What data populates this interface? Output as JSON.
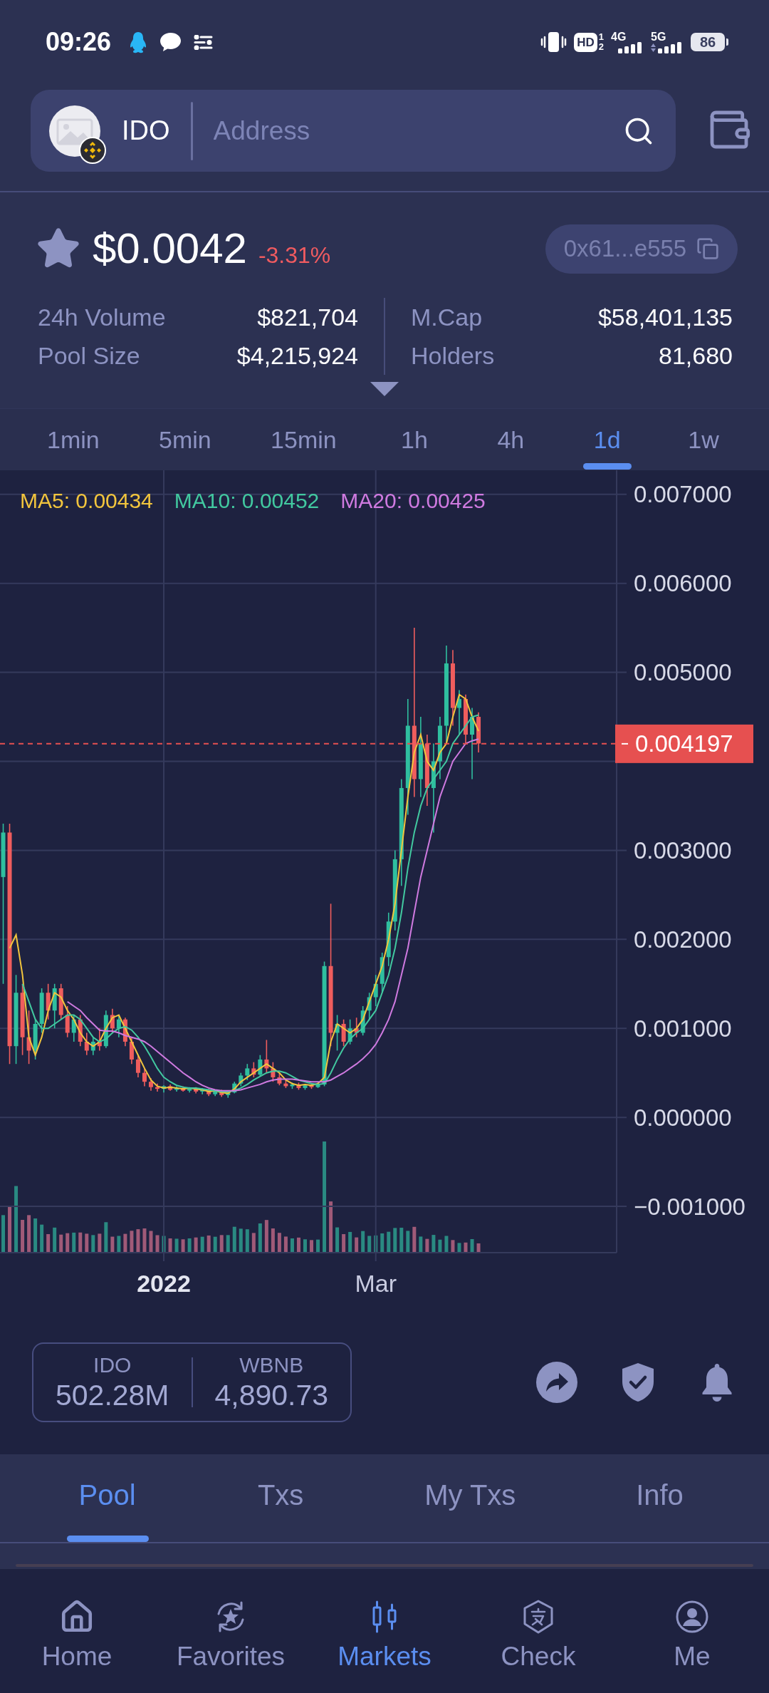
{
  "status_bar": {
    "time": "09:26",
    "hd": {
      "label": "HD",
      "slots": [
        "1",
        "2"
      ]
    },
    "networks": [
      "4G",
      "5G"
    ],
    "battery": "86"
  },
  "search_bar": {
    "token": "IDO",
    "placeholder": "Address"
  },
  "token": {
    "price": "$0.0042",
    "change": "-3.31%",
    "address": "0x61...e555"
  },
  "stats": [
    [
      {
        "label": "24h Volume",
        "value": "$821,704"
      },
      {
        "label": "Pool Size",
        "value": "$4,215,924"
      }
    ],
    [
      {
        "label": "M.Cap",
        "value": "$58,401,135"
      },
      {
        "label": "Holders",
        "value": "81,680"
      }
    ]
  ],
  "intervals": [
    {
      "label": "1min",
      "selected": false
    },
    {
      "label": "5min",
      "selected": false
    },
    {
      "label": "15min",
      "selected": false
    },
    {
      "label": "1h",
      "selected": false
    },
    {
      "label": "4h",
      "selected": false
    },
    {
      "label": "1d",
      "selected": true
    },
    {
      "label": "1w",
      "selected": false
    }
  ],
  "chart": {
    "legend": [
      {
        "value": ": 0.00434"
      },
      {
        "value": ": 0.00452"
      },
      {
        "value": ": 0.00425"
      }
    ],
    "chart_data": {
      "type": "candlestick",
      "grid": true,
      "categories": [
        null,
        null,
        null,
        null,
        null,
        null,
        null,
        null,
        null,
        null,
        null,
        null,
        null,
        null,
        null,
        null,
        null,
        null,
        null,
        null,
        null,
        null,
        null,
        null,
        null,
        "2022",
        null,
        null,
        null,
        null,
        null,
        null,
        null,
        null,
        null,
        null,
        null,
        null,
        null,
        null,
        null,
        null,
        null,
        null,
        null,
        null,
        null,
        null,
        null,
        null,
        null,
        null,
        null,
        null,
        null,
        null,
        null,
        null,
        "Mar",
        null,
        null,
        null,
        null,
        null,
        null,
        null,
        null,
        null,
        null,
        null,
        null,
        null,
        null,
        null,
        null,
        null,
        null,
        null,
        null,
        null,
        null,
        null,
        null,
        null,
        null,
        null,
        null,
        null,
        null,
        null,
        null,
        null,
        null,
        null,
        null,
        null
      ],
      "ylim": [
        -0.00152,
        0.00727
      ],
      "yticks": [
        {
          "value": 0.007,
          "label": "0.007000"
        },
        {
          "value": 0.006,
          "label": "0.006000"
        },
        {
          "value": 0.005,
          "label": "0.005000"
        },
        {
          "value": 0.003,
          "label": "0.003000"
        },
        {
          "value": 0.002,
          "label": "0.002000"
        },
        {
          "value": 0.001,
          "label": "0.001000"
        },
        {
          "value": 0,
          "label": "0.000000"
        },
        {
          "value": -0.001,
          "label": "−0.001000"
        }
      ],
      "ohlc": [
        [
          0.0027,
          0.0033,
          0.0015,
          0.0032
        ],
        [
          0.0032,
          0.0033,
          0.0006,
          0.0008
        ],
        [
          0.0008,
          0.0016,
          0.0006,
          0.0014
        ],
        [
          0.0014,
          0.0015,
          0.0007,
          0.0009
        ],
        [
          0.0009,
          0.0012,
          0.0006,
          0.00075
        ],
        [
          0.00075,
          0.0011,
          0.00065,
          0.00105
        ],
        [
          0.00105,
          0.00145,
          0.00095,
          0.0014
        ],
        [
          0.0014,
          0.0015,
          0.0011,
          0.0012
        ],
        [
          0.0012,
          0.0015,
          0.001,
          0.00145
        ],
        [
          0.00145,
          0.0015,
          0.0011,
          0.00115
        ],
        [
          0.00115,
          0.00125,
          0.0009,
          0.00095
        ],
        [
          0.00095,
          0.00115,
          0.00085,
          0.0011
        ],
        [
          0.0011,
          0.00115,
          0.0008,
          0.00085
        ],
        [
          0.00085,
          0.00095,
          0.0007,
          0.00075
        ],
        [
          0.00075,
          0.0009,
          0.0007,
          0.00085
        ],
        [
          0.00085,
          0.001,
          0.00075,
          0.0008
        ],
        [
          0.0008,
          0.0012,
          0.00078,
          0.00115
        ],
        [
          0.00115,
          0.00122,
          0.00095,
          0.001
        ],
        [
          0.001,
          0.00115,
          0.0009,
          0.0011
        ],
        [
          0.0011,
          0.00112,
          0.0008,
          0.00085
        ],
        [
          0.00085,
          0.0009,
          0.0006,
          0.00065
        ],
        [
          0.00065,
          0.0007,
          0.00045,
          0.0005
        ],
        [
          0.0005,
          0.00055,
          0.00035,
          0.0004
        ],
        [
          0.0004,
          0.00044,
          0.0003,
          0.00034
        ],
        [
          0.00034,
          0.00038,
          0.00029,
          0.00032
        ],
        [
          0.00032,
          0.00036,
          0.00028,
          0.00035
        ],
        [
          0.00035,
          0.00037,
          0.0003,
          0.00031
        ],
        [
          0.00031,
          0.00035,
          0.00029,
          0.00033
        ],
        [
          0.00033,
          0.00035,
          0.00029,
          0.0003
        ],
        [
          0.0003,
          0.00034,
          0.00028,
          0.00032
        ],
        [
          0.00032,
          0.00034,
          0.00027,
          0.00029
        ],
        [
          0.00029,
          0.00033,
          0.00026,
          0.00031
        ],
        [
          0.00031,
          0.00032,
          0.00024,
          0.00026
        ],
        [
          0.00026,
          0.00031,
          0.00024,
          0.0003
        ],
        [
          0.0003,
          0.00031,
          0.00023,
          0.00025
        ],
        [
          0.00025,
          0.0003,
          0.00022,
          0.00028
        ],
        [
          0.00028,
          0.0004,
          0.00027,
          0.00038
        ],
        [
          0.00038,
          0.0005,
          0.00035,
          0.00047
        ],
        [
          0.00047,
          0.0006,
          0.00042,
          0.00055
        ],
        [
          0.00055,
          0.00062,
          0.00045,
          0.00048
        ],
        [
          0.00048,
          0.0007,
          0.00046,
          0.00065
        ],
        [
          0.00065,
          0.00087,
          0.0005,
          0.00055
        ],
        [
          0.00055,
          0.00062,
          0.0004,
          0.00045
        ],
        [
          0.00045,
          0.0005,
          0.00036,
          0.00038
        ],
        [
          0.00038,
          0.00042,
          0.00033,
          0.00035
        ],
        [
          0.00035,
          0.00039,
          0.00032,
          0.00037
        ],
        [
          0.00037,
          0.00039,
          0.00031,
          0.00033
        ],
        [
          0.00033,
          0.00037,
          0.00031,
          0.00036
        ],
        [
          0.00036,
          0.00038,
          0.00032,
          0.00034
        ],
        [
          0.00034,
          0.00039,
          0.00033,
          0.00037
        ],
        [
          0.00037,
          0.00175,
          0.00035,
          0.0017
        ],
        [
          0.0017,
          0.0024,
          0.0008,
          0.00095
        ],
        [
          0.00095,
          0.00115,
          0.00075,
          0.00105
        ],
        [
          0.00105,
          0.0011,
          0.0008,
          0.00085
        ],
        [
          0.00085,
          0.0011,
          0.00082,
          0.001
        ],
        [
          0.001,
          0.00112,
          0.0009,
          0.00095
        ],
        [
          0.00095,
          0.00125,
          0.00092,
          0.0012
        ],
        [
          0.0012,
          0.0014,
          0.0011,
          0.00135
        ],
        [
          0.00135,
          0.0016,
          0.00125,
          0.0015
        ],
        [
          0.0015,
          0.00185,
          0.0014,
          0.0018
        ],
        [
          0.0018,
          0.0023,
          0.0017,
          0.0022
        ],
        [
          0.0022,
          0.003,
          0.0021,
          0.0029
        ],
        [
          0.0029,
          0.0038,
          0.0026,
          0.0037
        ],
        [
          0.0037,
          0.0047,
          0.0034,
          0.0044
        ],
        [
          0.0044,
          0.0055,
          0.0036,
          0.0038
        ],
        [
          0.0038,
          0.0045,
          0.0036,
          0.0042
        ],
        [
          0.0042,
          0.0043,
          0.0035,
          0.0037
        ],
        [
          0.0037,
          0.0042,
          0.0032,
          0.004
        ],
        [
          0.004,
          0.0045,
          0.0038,
          0.0044
        ],
        [
          0.0044,
          0.0053,
          0.0042,
          0.0051
        ],
        [
          0.0051,
          0.00525,
          0.0044,
          0.0046
        ],
        [
          0.0046,
          0.0048,
          0.0043,
          0.0047
        ],
        [
          0.0047,
          0.00475,
          0.0042,
          0.0043
        ],
        [
          0.0043,
          0.0046,
          0.0038,
          0.0045
        ],
        [
          0.0045,
          0.00455,
          0.0041,
          0.0042
        ],
        null,
        null,
        null,
        null,
        null,
        null,
        null,
        null,
        null,
        null,
        null,
        null,
        null,
        null,
        null,
        null,
        null,
        null,
        null,
        null,
        null
      ],
      "series": [
        {
          "name": "MA5",
          "type": "line",
          "color": "#f2c53d",
          "values": [
            null,
            0.0019,
            0.00205,
            0.0016,
            0.0009,
            0.0007,
            0.0009,
            0.0012,
            0.0014,
            0.00135,
            0.0012,
            0.0011,
            0.00095,
            0.00085,
            0.0008,
            0.00085,
            0.001,
            0.00112,
            0.00115,
            0.001,
            0.00085,
            0.0007,
            0.00055,
            0.00042,
            0.00035,
            0.00033,
            0.00034,
            0.00033,
            0.00032,
            0.00033,
            0.00032,
            0.00031,
            0.00029,
            0.0003,
            0.00028,
            0.00027,
            0.00032,
            0.0004,
            0.00045,
            0.0005,
            0.00055,
            0.0006,
            0.00055,
            0.0005,
            0.00042,
            0.00038,
            0.00036,
            0.00037,
            0.00036,
            0.00038,
            0.00045,
            0.00085,
            0.00105,
            0.001,
            0.00095,
            0.001,
            0.0011,
            0.0013,
            0.0015,
            0.0017,
            0.002,
            0.0024,
            0.003,
            0.0036,
            0.0041,
            0.0043,
            0.004,
            0.0039,
            0.0041,
            0.0042,
            0.0045,
            0.00475,
            0.0047,
            0.0045,
            0.00434,
            null,
            null,
            null,
            null,
            null,
            null,
            null,
            null,
            null,
            null,
            null,
            null,
            null,
            null,
            null,
            null,
            null,
            null,
            null,
            null,
            null
          ]
        },
        {
          "name": "MA10",
          "type": "line",
          "color": "#42c9a0",
          "values": [
            null,
            null,
            null,
            0.0015,
            0.0013,
            0.0011,
            0.001,
            0.001,
            0.00105,
            0.0011,
            0.00115,
            0.00115,
            0.0011,
            0.001,
            0.0009,
            0.00085,
            0.00088,
            0.00095,
            0.001,
            0.00102,
            0.00098,
            0.0009,
            0.0008,
            0.00068,
            0.00055,
            0.00045,
            0.0004,
            0.00036,
            0.00034,
            0.00033,
            0.00033,
            0.00032,
            0.00031,
            0.0003,
            0.00029,
            0.00029,
            0.0003,
            0.00033,
            0.00037,
            0.00042,
            0.00046,
            0.0005,
            0.00052,
            0.00052,
            0.0005,
            0.00046,
            0.00042,
            0.0004,
            0.00038,
            0.00037,
            0.00038,
            0.0005,
            0.00065,
            0.00078,
            0.00088,
            0.00095,
            0.001,
            0.0011,
            0.0012,
            0.0014,
            0.0016,
            0.0019,
            0.0023,
            0.0028,
            0.0032,
            0.0035,
            0.0037,
            0.0038,
            0.0039,
            0.004,
            0.0042,
            0.0043,
            0.0044,
            0.0045,
            0.00452,
            null,
            null,
            null,
            null,
            null,
            null,
            null,
            null,
            null,
            null,
            null,
            null,
            null,
            null,
            null,
            null,
            null,
            null,
            null,
            null,
            null
          ]
        },
        {
          "name": "MA20",
          "type": "line",
          "color": "#cf7ae0",
          "values": [
            null,
            null,
            null,
            null,
            null,
            null,
            null,
            null,
            null,
            null,
            0.0013,
            0.00125,
            0.0012,
            0.00112,
            0.00105,
            0.00098,
            0.00097,
            0.00097,
            0.00095,
            0.00092,
            0.0009,
            0.00088,
            0.00085,
            0.0008,
            0.00074,
            0.00068,
            0.00062,
            0.00056,
            0.0005,
            0.00045,
            0.0004,
            0.00036,
            0.00033,
            0.00031,
            0.0003,
            0.0003,
            0.0003,
            0.00031,
            0.00033,
            0.00035,
            0.00037,
            0.0004,
            0.00042,
            0.00043,
            0.00043,
            0.00043,
            0.00042,
            0.00041,
            0.0004,
            0.0004,
            0.0004,
            0.00042,
            0.00046,
            0.0005,
            0.00055,
            0.0006,
            0.00066,
            0.00073,
            0.00082,
            0.00095,
            0.0011,
            0.0013,
            0.0016,
            0.0019,
            0.0023,
            0.0027,
            0.003,
            0.0033,
            0.0036,
            0.0038,
            0.004,
            0.0041,
            0.0042,
            0.00423,
            0.00425,
            null,
            null,
            null,
            null,
            null,
            null,
            null,
            null,
            null,
            null,
            null,
            null,
            null,
            null,
            null,
            null,
            null,
            null,
            null,
            null,
            null
          ]
        }
      ],
      "ref_lines": [
        {
          "axis": "y",
          "value": 0.004197,
          "label": "0.004197"
        }
      ]
    }
  },
  "reserves": [
    {
      "token": "IDO",
      "amount": "502.28M"
    },
    {
      "token": "WBNB",
      "amount": "4,890.73"
    }
  ],
  "detail_tabs": [
    {
      "label": "Pool",
      "selected": true
    },
    {
      "label": "Txs",
      "selected": false
    },
    {
      "label": "My Txs",
      "selected": false
    },
    {
      "label": "Info",
      "selected": false
    }
  ],
  "bottom_nav": [
    {
      "label": "Home",
      "selected": false
    },
    {
      "label": "Favorites",
      "selected": false
    },
    {
      "label": "Markets",
      "selected": true
    },
    {
      "label": "Check",
      "selected": false
    },
    {
      "label": "Me",
      "selected": false
    }
  ]
}
